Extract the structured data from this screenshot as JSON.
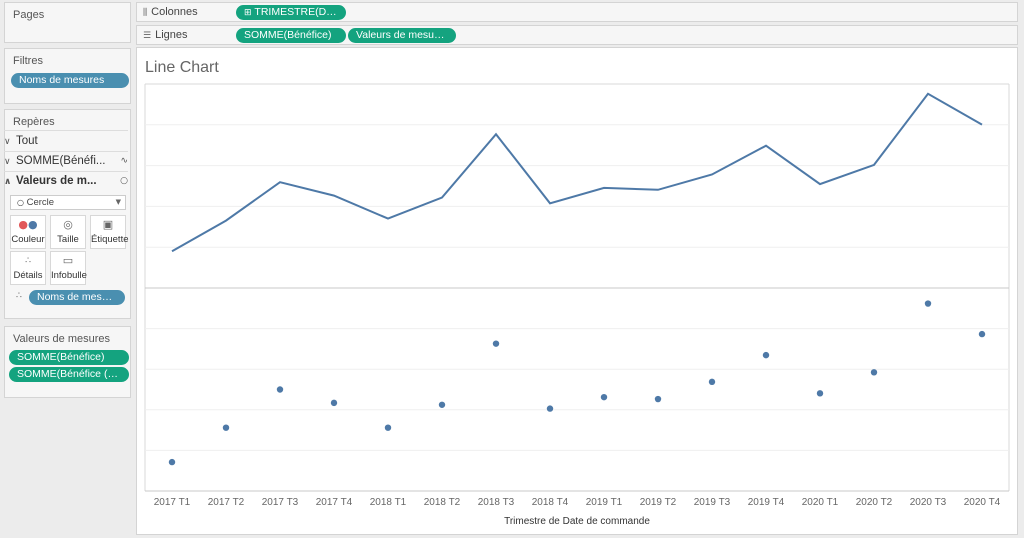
{
  "pages_panel": {
    "title": "Pages"
  },
  "filters_panel": {
    "title": "Filtres",
    "pill": "Noms de mesures"
  },
  "marks_panel": {
    "title": "Repères",
    "rows": [
      {
        "label": "Tout",
        "icon": ""
      },
      {
        "label": "SOMME(Bénéfi...",
        "icon": "line-mark-icon"
      },
      {
        "label": "Valeurs de m...",
        "icon": "circle-mark-icon"
      }
    ],
    "mark_type": "Cercle",
    "buttons": [
      {
        "label": "Couleur",
        "icon": "color-dots-icon"
      },
      {
        "label": "Taille",
        "icon": "size-icon"
      },
      {
        "label": "Étiquette",
        "icon": "label-icon"
      },
      {
        "label": "Détails",
        "icon": "details-icon"
      },
      {
        "label": "Infobulle",
        "icon": "tooltip-icon"
      }
    ],
    "detail_pill": "Noms de mesures"
  },
  "measure_values_panel": {
    "title": "Valeurs de mesures",
    "pills": [
      "SOMME(Bénéfice)",
      "SOMME(Bénéfice (cop..."
    ]
  },
  "shelves": {
    "columns": {
      "label": "Colonnes",
      "pill": "TRIMESTRE(Date ..."
    },
    "rows": {
      "label": "Lignes",
      "pills": [
        "SOMME(Bénéfice)",
        "Valeurs de mesures"
      ]
    }
  },
  "colors": {
    "accent_green": "#14a37f",
    "accent_blue": "#4a8fb0",
    "series": "#4e79a7"
  },
  "chart_data": {
    "type": "line",
    "title": "Line Chart",
    "xlabel": "Trimestre de Date de commande",
    "ylabel": "",
    "categories": [
      "2017 T1",
      "2017 T2",
      "2017 T3",
      "2017 T4",
      "2018 T1",
      "2018 T2",
      "2018 T3",
      "2018 T4",
      "2019 T1",
      "2019 T2",
      "2019 T3",
      "2019 T4",
      "2020 T1",
      "2020 T2",
      "2020 T3",
      "2020 T4"
    ],
    "panes": [
      {
        "type": "line",
        "values": [
          0.16,
          0.32,
          0.52,
          0.45,
          0.33,
          0.44,
          0.77,
          0.41,
          0.49,
          0.48,
          0.56,
          0.71,
          0.51,
          0.61,
          0.98,
          0.82
        ],
        "ylim": [
          0,
          1
        ]
      },
      {
        "type": "scatter",
        "values": [
          0.12,
          0.3,
          0.5,
          0.43,
          0.3,
          0.42,
          0.74,
          0.4,
          0.46,
          0.45,
          0.54,
          0.68,
          0.48,
          0.59,
          0.95,
          0.79
        ],
        "ylim": [
          0,
          1
        ]
      }
    ],
    "grid": true,
    "legend": "none"
  }
}
